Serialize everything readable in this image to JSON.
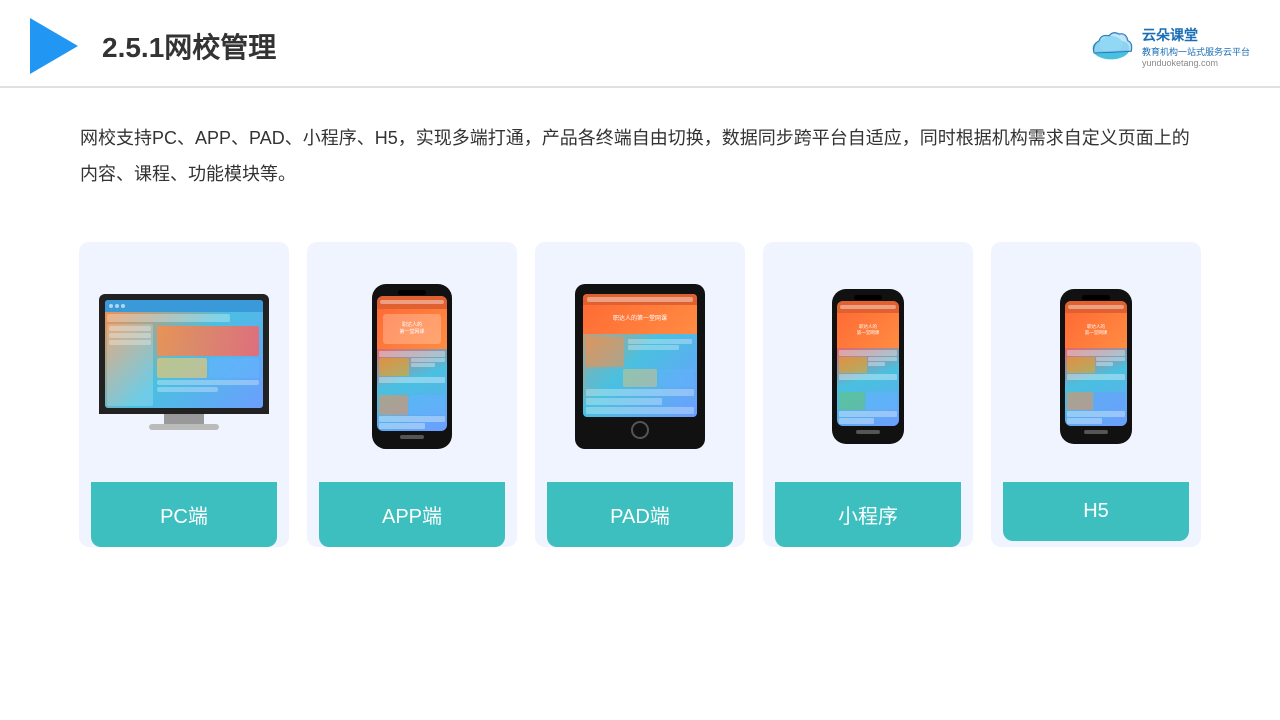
{
  "header": {
    "title": "2.5.1网校管理",
    "brand": {
      "name": "云朵课堂",
      "subtitle": "教育机构一站式服务云平台",
      "url": "yunduoketang.com"
    }
  },
  "description": "网校支持PC、APP、PAD、小程序、H5，实现多端打通，产品各终端自由切换，数据同步跨平台自适应，同时根据机构需求自定义页面上的内容、课程、功能模块等。",
  "cards": [
    {
      "id": "pc",
      "label": "PC端"
    },
    {
      "id": "app",
      "label": "APP端"
    },
    {
      "id": "pad",
      "label": "PAD端"
    },
    {
      "id": "miniprogram",
      "label": "小程序"
    },
    {
      "id": "h5",
      "label": "H5"
    }
  ],
  "colors": {
    "accent": "#3dbfbf",
    "header_border": "#e0e0e0",
    "card_bg": "#f0f4ff",
    "brand_blue": "#1a6eb5"
  }
}
